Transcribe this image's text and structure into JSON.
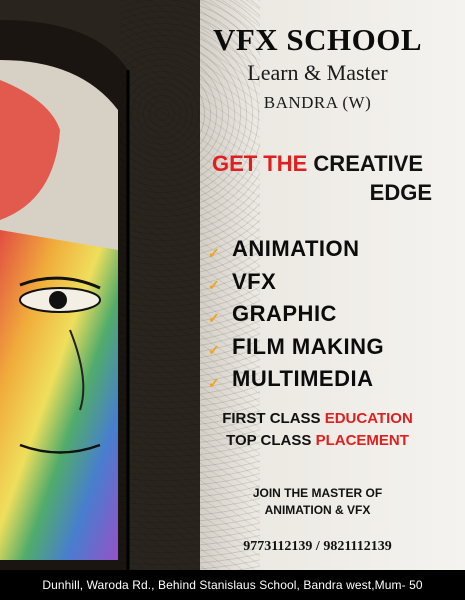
{
  "brand": {
    "title": "VFX SCHOOL",
    "subtitle": "Learn & Master",
    "location": "BANDRA (W)"
  },
  "tagline": {
    "part1_red": "GET THE",
    "part1_black": "CREATIVE",
    "part2": "EDGE"
  },
  "courses": [
    {
      "label": "ANIMATION",
      "icon": "check-icon"
    },
    {
      "label": "VFX",
      "icon": "check-icon"
    },
    {
      "label": "GRAPHIC",
      "icon": "check-icon"
    },
    {
      "label": "FILM MAKING",
      "icon": "check-icon"
    },
    {
      "label": "MULTIMEDIA",
      "icon": "check-icon"
    }
  ],
  "highlights": {
    "line1_black": "FIRST CLASS",
    "line1_red": "EDUCATION",
    "line2_black": "TOP CLASS",
    "line2_red": "PLACEMENT"
  },
  "join": {
    "line1": "JOIN THE MASTER OF",
    "line2": "ANIMATION & VFX"
  },
  "contact": {
    "phones": "9773112139 / 9821112139",
    "address": "Dunhill, Waroda Rd., Behind Stanislaus School, Bandra west,Mum- 50"
  },
  "colors": {
    "accent_red": "#e01f1f",
    "check_orange": "#f2a11c",
    "footer_bg": "#000000"
  }
}
